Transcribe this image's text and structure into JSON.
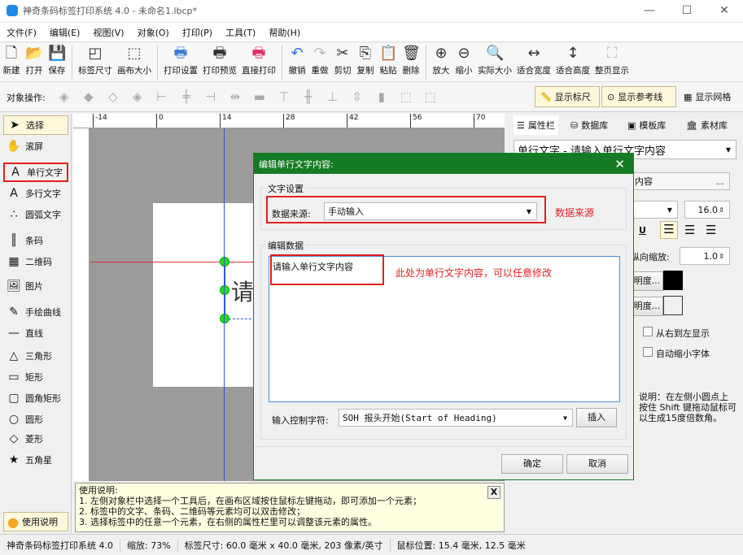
{
  "window": {
    "title": "神奇条码标签打印系统 4.0 - 未命名1.lbcp*",
    "minimize": "—",
    "maximize": "☐",
    "close": "✕"
  },
  "menu": [
    "文件(F)",
    "编辑(E)",
    "视图(V)",
    "对象(O)",
    "打印(P)",
    "工具(T)",
    "帮助(H)"
  ],
  "toolbar": [
    {
      "label": "新建",
      "icon": "new-file-icon",
      "glyph": "🗋"
    },
    {
      "label": "打开",
      "icon": "open-icon",
      "glyph": "📂"
    },
    {
      "label": "保存",
      "icon": "save-icon",
      "glyph": "💾"
    },
    {
      "label": "标签尺寸",
      "icon": "label-size-icon",
      "glyph": "◰"
    },
    {
      "label": "画布大小",
      "icon": "canvas-size-icon",
      "glyph": "⬚"
    },
    {
      "label": "打印设置",
      "icon": "print-settings-icon",
      "glyph": "🖶"
    },
    {
      "label": "打印预览",
      "icon": "print-preview-icon",
      "glyph": "🖶"
    },
    {
      "label": "直接打印",
      "icon": "print-icon",
      "glyph": "🖶"
    },
    {
      "label": "撤销",
      "icon": "undo-icon",
      "glyph": "↶"
    },
    {
      "label": "重做",
      "icon": "redo-icon",
      "glyph": "↷"
    },
    {
      "label": "剪切",
      "icon": "cut-icon",
      "glyph": "✂"
    },
    {
      "label": "复制",
      "icon": "copy-icon",
      "glyph": "⎘"
    },
    {
      "label": "粘贴",
      "icon": "paste-icon",
      "glyph": "📋"
    },
    {
      "label": "删除",
      "icon": "delete-icon",
      "glyph": "🗑"
    },
    {
      "label": "放大",
      "icon": "zoom-in-icon",
      "glyph": "⊕"
    },
    {
      "label": "缩小",
      "icon": "zoom-out-icon",
      "glyph": "⊖"
    },
    {
      "label": "实际大小",
      "icon": "actual-size-icon",
      "glyph": "🔍"
    },
    {
      "label": "适合宽度",
      "icon": "fit-width-icon",
      "glyph": "↔"
    },
    {
      "label": "适合高度",
      "icon": "fit-height-icon",
      "glyph": "↕"
    },
    {
      "label": "整页显示",
      "icon": "full-page-icon",
      "glyph": "⛶"
    }
  ],
  "objbar": {
    "label": "对象操作:",
    "show_ruler": "显示标尺",
    "show_guides": "显示参考线",
    "show_grid": "显示网格"
  },
  "tools": [
    {
      "label": "选择",
      "glyph": "➤"
    },
    {
      "label": "滚屏",
      "glyph": "✋"
    },
    {
      "label": "单行文字",
      "glyph": "A"
    },
    {
      "label": "多行文字",
      "glyph": "A"
    },
    {
      "label": "圆弧文字",
      "glyph": "∴"
    },
    {
      "label": "条码",
      "glyph": "║"
    },
    {
      "label": "二维码",
      "glyph": "▦"
    },
    {
      "label": "图片",
      "glyph": "🖼"
    },
    {
      "label": "手绘曲线",
      "glyph": "✎"
    },
    {
      "label": "直线",
      "glyph": "—"
    },
    {
      "label": "三角形",
      "glyph": "△"
    },
    {
      "label": "矩形",
      "glyph": "▭"
    },
    {
      "label": "圆角矩形",
      "glyph": "▢"
    },
    {
      "label": "圆形",
      "glyph": "○"
    },
    {
      "label": "菱形",
      "glyph": "◇"
    },
    {
      "label": "五角星",
      "glyph": "★"
    }
  ],
  "help_button": "使用说明",
  "ruler_ticks": [
    "-14",
    "0",
    "14",
    "28",
    "42",
    "56",
    "70"
  ],
  "canvas_text": "请",
  "right_panel": {
    "tabs": [
      "属性栏",
      "数据库",
      "模板库",
      "素材库"
    ],
    "object_select": "单行文字 - 请输入单行文字内容",
    "content_field": "内容",
    "more": "...",
    "font_size": "16.0",
    "underline": "U",
    "vscale_label": "纵向缩放:",
    "vscale": "1.0",
    "color_btn": "明度...",
    "bg_btn": "明度...",
    "rtl": "从右到左显示",
    "autoshrink": "自动缩小字体",
    "note": "说明：在左侧小圆点上按住 Shift 键拖动鼠标可以生成15度倍数角。"
  },
  "dialog": {
    "title": "编辑单行文字内容:",
    "text_settings": "文字设置",
    "source_label": "数据来源:",
    "source_value": "手动输入",
    "source_annotation": "数据来源",
    "edit_data": "编辑数据",
    "content": "请输入单行文字内容",
    "content_annotation": "此处为单行文字内容，可以任意修改",
    "ctrl_label": "输入控制字符:",
    "ctrl_value": "SOH  报头开始(Start of Heading)",
    "insert": "插入",
    "ok": "确定",
    "cancel": "取消"
  },
  "help": {
    "title": "使用说明:",
    "lines": [
      "1. 左侧对象栏中选择一个工具后，在画布区域按住鼠标左键拖动，即可添加一个元素；",
      "2. 标签中的文字、条码、二维码等元素均可以双击修改；",
      "3. 选择标签中的任意一个元素，在右侧的属性栏里可以调整该元素的属性。"
    ],
    "close": "X"
  },
  "status": {
    "app": "神奇条码标签打印系统 4.0",
    "zoom": "缩放: 73%",
    "size": "标签尺寸: 60.0 毫米 x 40.0 毫米, 203 像素/英寸",
    "mouse": "鼠标位置: 15.4 毫米, 12.5 毫米"
  }
}
